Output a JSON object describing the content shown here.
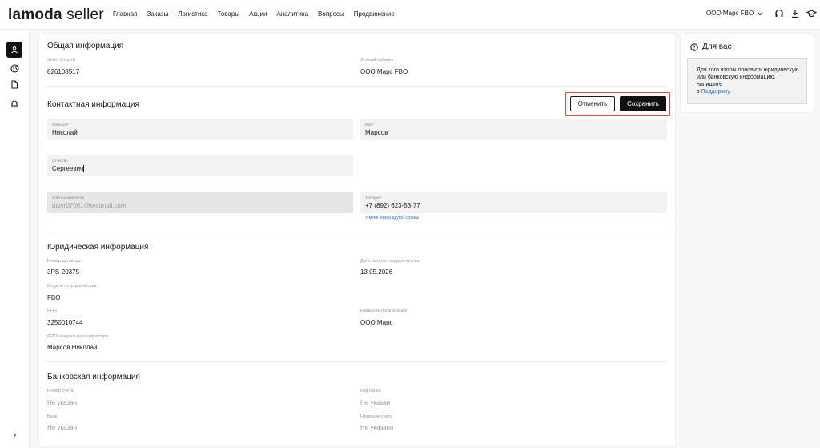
{
  "header": {
    "logo_brand": "lamoda",
    "logo_suffix": "seller",
    "nav": [
      "Главная",
      "Заказы",
      "Логистика",
      "Товары",
      "Акции",
      "Аналитика",
      "Вопросы",
      "Продвижение"
    ],
    "shop_name": "ООО Марс FBO",
    "icons": [
      "headset-icon",
      "download-icon",
      "graduation-cap-icon"
    ]
  },
  "sidebar": {
    "items": [
      "user-icon",
      "globe-icon",
      "document-icon",
      "bell-icon"
    ],
    "expand_icon": "chevron-right-icon"
  },
  "general": {
    "title": "Общая информация",
    "shop_id_label": "Seller Shop ID",
    "shop_id": "826108517",
    "cabinet_label": "Личный кабинет",
    "cabinet": "ООО Марс FBO"
  },
  "contact": {
    "title": "Контактная информация",
    "cancel": "Отменить",
    "save": "Сохранить",
    "last_name_label": "Фамилия*",
    "last_name": "Николай",
    "first_name_label": "Имя*",
    "first_name": "Марсов",
    "patronymic_label": "Отчество",
    "patronymic": "Сергеевич",
    "email_label": "Электронная почта",
    "email": "daivr07061@testmail.com",
    "phone_label": "Телефон*",
    "phone": "+7 (892) 623-53-77",
    "phone_link": "У меня номер другой страны"
  },
  "legal": {
    "title": "Юридическая информация",
    "contract_label": "Номер договора",
    "contract": "3PS-20375",
    "start_label": "Дата начала сотрудничества",
    "start": "13.05.2026",
    "model_label": "Модель сотрудничества",
    "model": "FBO",
    "inn_label": "ИНН",
    "inn": "3250010744",
    "org_label": "Название организации",
    "org": "ООО Марс",
    "director_label": "ФИО генерального директора",
    "director": "Марсов Николай"
  },
  "bank": {
    "title": "Банковская информация",
    "account_label": "Номер счёта",
    "account": "Не указан",
    "code_label": "Код банка",
    "code": "Не указан",
    "bank_label": "Банк",
    "bank": "Не указан",
    "acc_name_label": "Название счета",
    "acc_name": "Не указано"
  },
  "side_panel": {
    "title": "Для вас",
    "text": "Для того чтобы обновить юридическую или банковскую информацию, напишите",
    "link_prefix": "в",
    "link": "Поддержку."
  },
  "colors": {
    "accent_link": "#2a6fdb",
    "highlight_border": "#e34a3b",
    "primary_button": "#111111"
  }
}
